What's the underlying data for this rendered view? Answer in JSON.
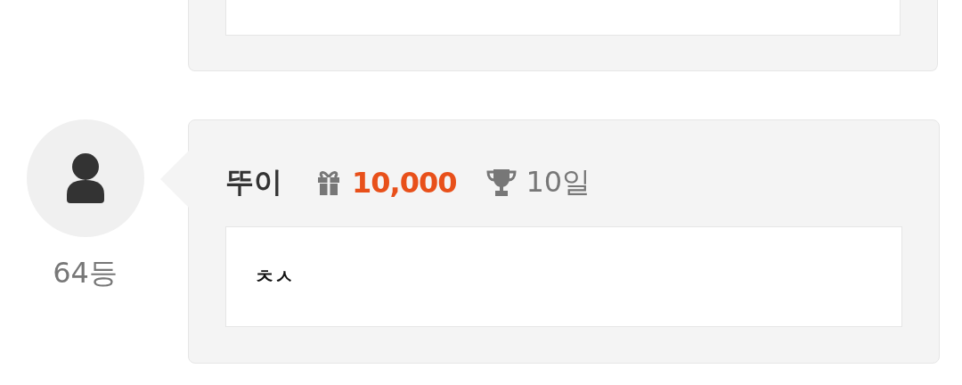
{
  "comments": [
    {
      "user": "뚜이",
      "rank": "64등",
      "gift": "10,000",
      "days": "10일",
      "message": "ㅊㅅ"
    }
  ]
}
